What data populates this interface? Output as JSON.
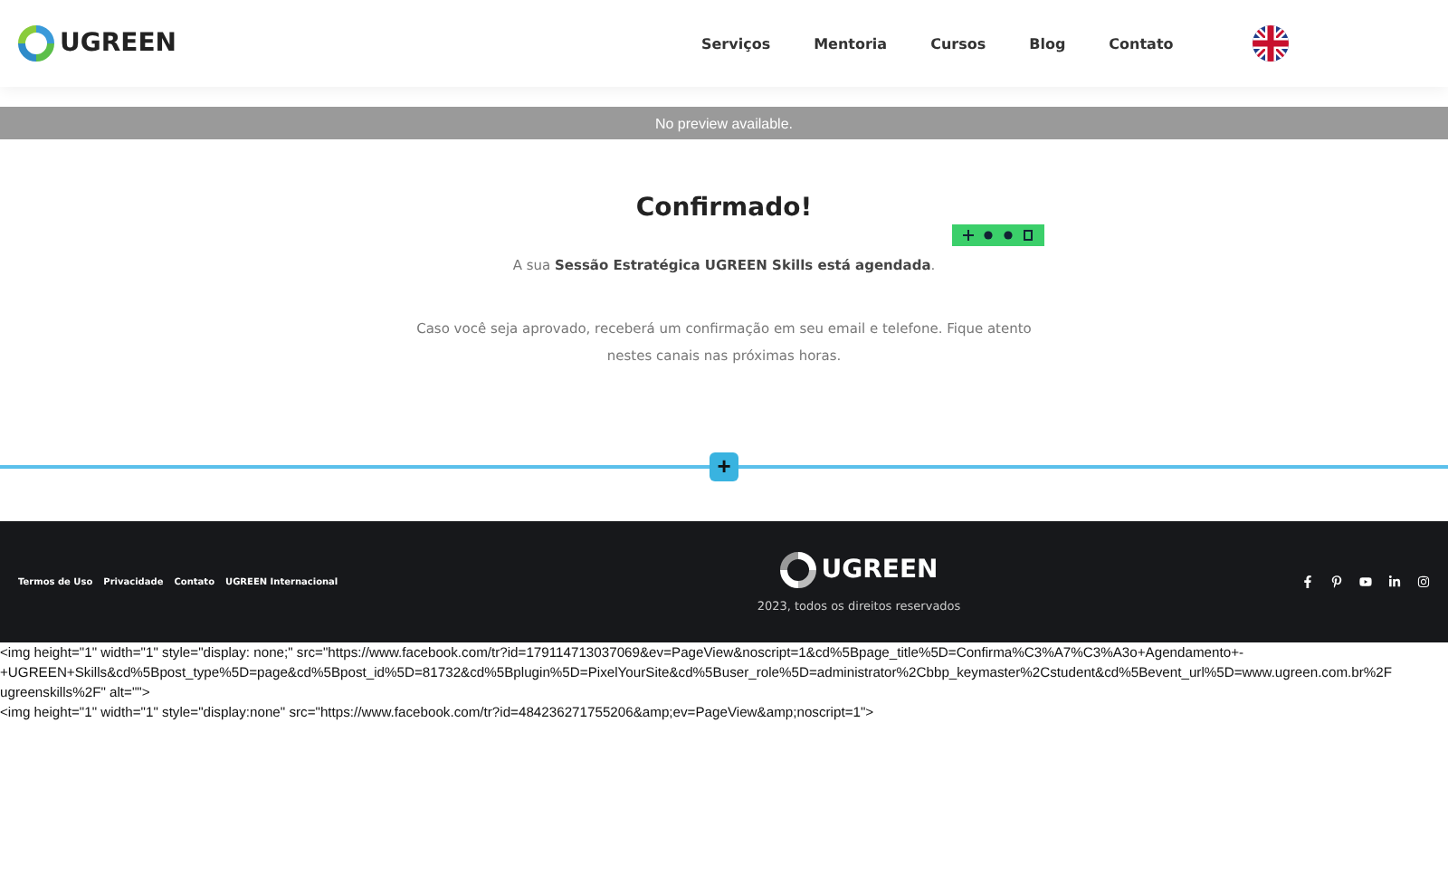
{
  "header": {
    "logo": "UGREEN",
    "nav": [
      {
        "label": "Serviços"
      },
      {
        "label": "Mentoria"
      },
      {
        "label": "Cursos"
      },
      {
        "label": "Blog"
      },
      {
        "label": "Contato"
      }
    ]
  },
  "preview_bar": {
    "text": "No preview available."
  },
  "content": {
    "title": "Confirmado!",
    "lines": [
      "A sua **Sessão Estratégica UGREEN Skills está agendada**.",
      "Caso você seja aprovado, receberá um confirmação em seu email e telefone. Fique atento nestes canais nas próximas horas."
    ]
  },
  "add_section": {
    "label": "+"
  },
  "footer": {
    "links": [
      "Termos de Uso",
      "Privacidade",
      "Contato",
      "UGREEN Internacional"
    ],
    "logo": "UGREEN",
    "copyright": "2023, todos os direitos reservados"
  },
  "raw_code": [
    "<img height=\"1\" width=\"1\" style=\"display: none;\" src=\"https://www.facebook.com/tr?id=179114713037069&ev=PageView&noscript=1&cd%5Bpage_title%5D=Confirma%C3%A7%C3%A3o+Agendamento+-",
    "+UGREEN+Skills&cd%5Bpost_type%5D=page&cd%5Bpost_id%5D=81732&cd%5Bplugin%5D=PixelYourSite&cd%5Buser_role%5D=administrator%2Cbbp_keymaster%2Cstudent&cd%5Bevent_url%5D=www.ugreen.com.br%2F",
    "ugreenskills%2F\" alt=\"\">",
    "<img height=\"1\" width=\"1\" style=\"display:none\" src=\"https://www.facebook.com/tr?id=484236271755206&amp;ev=PageView&amp;noscript=1\">"
  ]
}
